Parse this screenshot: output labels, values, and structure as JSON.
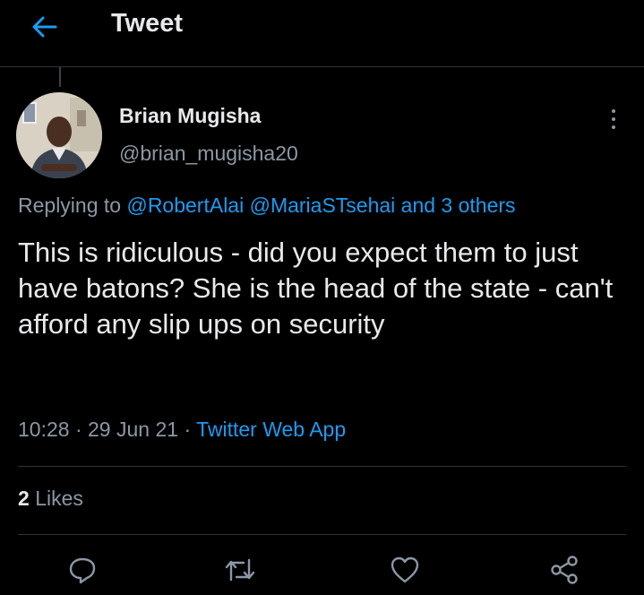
{
  "header": {
    "title": "Tweet",
    "back_icon": "arrow-left-icon",
    "accent_color": "#1d9bf0"
  },
  "tweet": {
    "author": {
      "name": "Brian Mugisha",
      "handle": "@brian_mugisha20"
    },
    "replying_to": {
      "prefix": "Replying to",
      "users": [
        "@RobertAlai",
        "@MariaSTsehai"
      ],
      "others": "and 3 others"
    },
    "text": "This is ridiculous - did you expect them to just have batons? She is the head of the state - can't afford any slip ups on security",
    "time": "10:28",
    "date": "29 Jun 21",
    "separator": "·",
    "source": "Twitter Web App",
    "likes": {
      "count": "2",
      "label": "Likes"
    }
  },
  "actions": [
    "reply-icon",
    "retweet-icon",
    "like-icon",
    "share-icon"
  ],
  "colors": {
    "background": "#000000",
    "text": "#e7e9ea",
    "secondary": "#8b98a5",
    "link": "#1d9bf0",
    "divider": "#2f3336"
  }
}
